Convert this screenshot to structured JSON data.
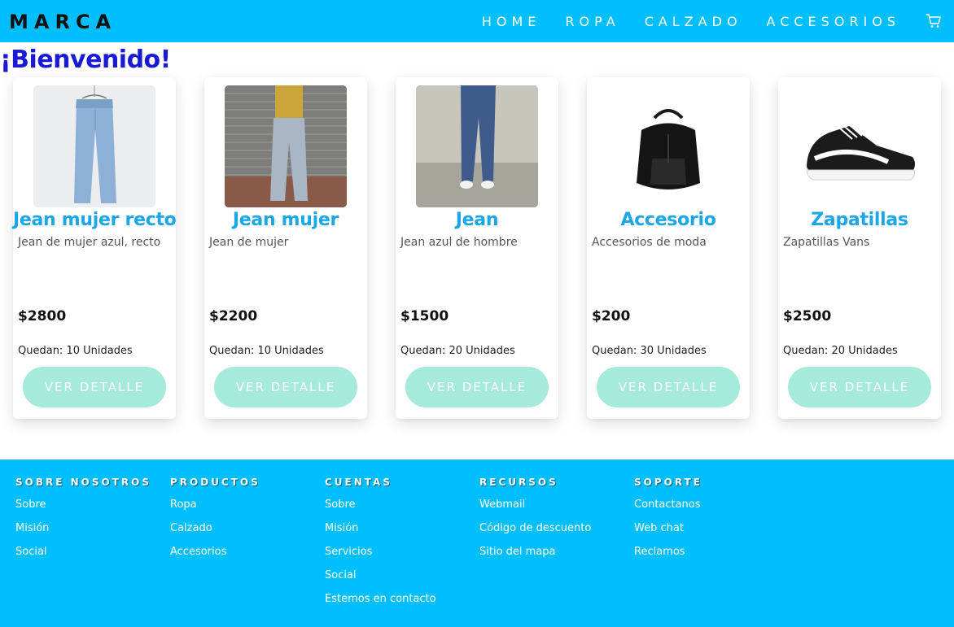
{
  "nav": {
    "brand": "MARCA",
    "links": [
      "HOME",
      "ROPA",
      "CALZADO",
      "ACCESORIOS"
    ],
    "cart_icon": "cart-icon"
  },
  "welcome": "¡Bienvenido!",
  "products": [
    {
      "title": "Jean mujer recto",
      "desc": "Jean de mujer azul, recto",
      "price": "$2800",
      "stock": "Quedan: 10 Unidades",
      "button": "VER DETALLE",
      "image": "light-jeans-product-photo"
    },
    {
      "title": "Jean mujer",
      "desc": "Jean de mujer",
      "price": "$2200",
      "stock": "Quedan: 10 Unidades",
      "button": "VER DETALLE",
      "image": "woman-jeans-photo"
    },
    {
      "title": "Jean",
      "desc": "Jean azul de hombre",
      "price": "$1500",
      "stock": "Quedan: 20 Unidades",
      "button": "VER DETALLE",
      "image": "man-jeans-photo"
    },
    {
      "title": "Accesorio",
      "desc": "Accesorios de moda",
      "price": "$200",
      "stock": "Quedan: 30 Unidades",
      "button": "VER DETALLE",
      "image": "black-backpack-photo"
    },
    {
      "title": "Zapatillas",
      "desc": "Zapatillas Vans",
      "price": "$2500",
      "stock": "Quedan: 20 Unidades",
      "button": "VER DETALLE",
      "image": "sneaker-photo"
    }
  ],
  "footer": {
    "columns": [
      {
        "heading": "SOBRE NOSOTROS",
        "links": [
          "Sobre",
          "Misión",
          "Social"
        ]
      },
      {
        "heading": "PRODUCTOS",
        "links": [
          "Ropa",
          "Calzado",
          "Accesorios"
        ]
      },
      {
        "heading": "CUENTAS",
        "links": [
          "Sobre",
          "Misión",
          "Servicios",
          "Social",
          "Estemos en contacto"
        ]
      },
      {
        "heading": "RECURSOS",
        "links": [
          "Webmail",
          "Código de descuento",
          "Sitio del mapa"
        ]
      },
      {
        "heading": "SOPORTE",
        "links": [
          "Contactanos",
          "Web chat",
          "Reclamos"
        ]
      }
    ]
  },
  "colors": {
    "primary": "#00bfff",
    "title": "#1aa6e8",
    "welcome": "#1a1ad6",
    "button": "#a5eadb"
  }
}
